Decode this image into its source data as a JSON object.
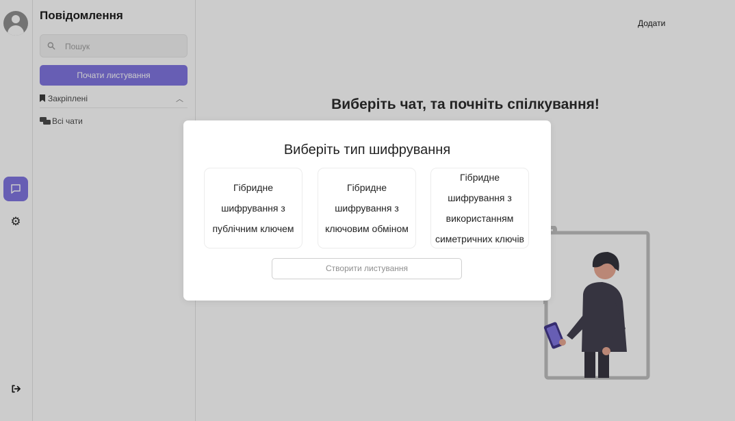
{
  "sidebar": {
    "title": "Повідомлення",
    "search_placeholder": "Пошук",
    "start_button": "Почати листування",
    "pinned_label": "Закріплені",
    "all_chats_label": "Всі чати"
  },
  "main": {
    "add_label": "Додати",
    "title": "Виберіть чат, та почніть спілкування!"
  },
  "modal": {
    "title": "Виберіть тип шифрування",
    "options": [
      {
        "label": "Гібридне шифрування з публічним ключем"
      },
      {
        "label": "Гібридне шифрування з ключовим обміном"
      },
      {
        "label": "Гібридне шифрування з використанням симетричних ключів"
      }
    ],
    "create_button": "Створити листування"
  },
  "colors": {
    "accent": "#7b6fe0",
    "overlay": "#b3b3b3"
  },
  "icons": [
    "avatar-icon",
    "chat-icon",
    "gear-icon",
    "logout-icon",
    "search-icon",
    "bookmark-icon",
    "chats-icon",
    "chevron-up-icon"
  ]
}
